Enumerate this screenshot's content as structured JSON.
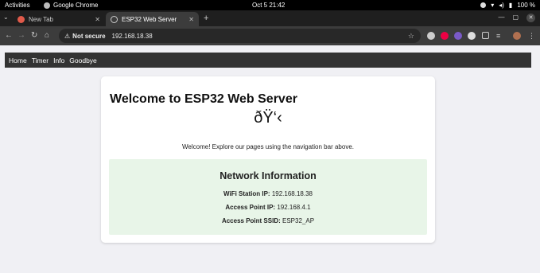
{
  "system_bar": {
    "activities": "Activities",
    "app_name": "Google Chrome",
    "clock": "Oct 5  21:42",
    "battery": "100 %"
  },
  "browser": {
    "tabs": [
      {
        "title": "New Tab",
        "active": false
      },
      {
        "title": "ESP32 Web Server",
        "active": true
      }
    ],
    "security_label": "Not secure",
    "url": "192.168.18.38"
  },
  "site": {
    "nav": [
      "Home",
      "Timer",
      "Info",
      "Goodbye"
    ],
    "heading": "Welcome to ESP32 Web Server",
    "emoji_text": "ðŸ‘‹",
    "welcome_text": "Welcome! Explore our pages using the navigation bar above.",
    "network": {
      "title": "Network Information",
      "rows": [
        {
          "label": "WiFi Station IP:",
          "value": "192.168.18.38"
        },
        {
          "label": "Access Point IP:",
          "value": "192.168.4.1"
        },
        {
          "label": "Access Point SSID:",
          "value": "ESP32_AP"
        }
      ]
    }
  },
  "colors": {
    "nav_bg": "#333333",
    "netbox_bg": "#e8f5e8",
    "page_bg": "#f0f0f4"
  }
}
